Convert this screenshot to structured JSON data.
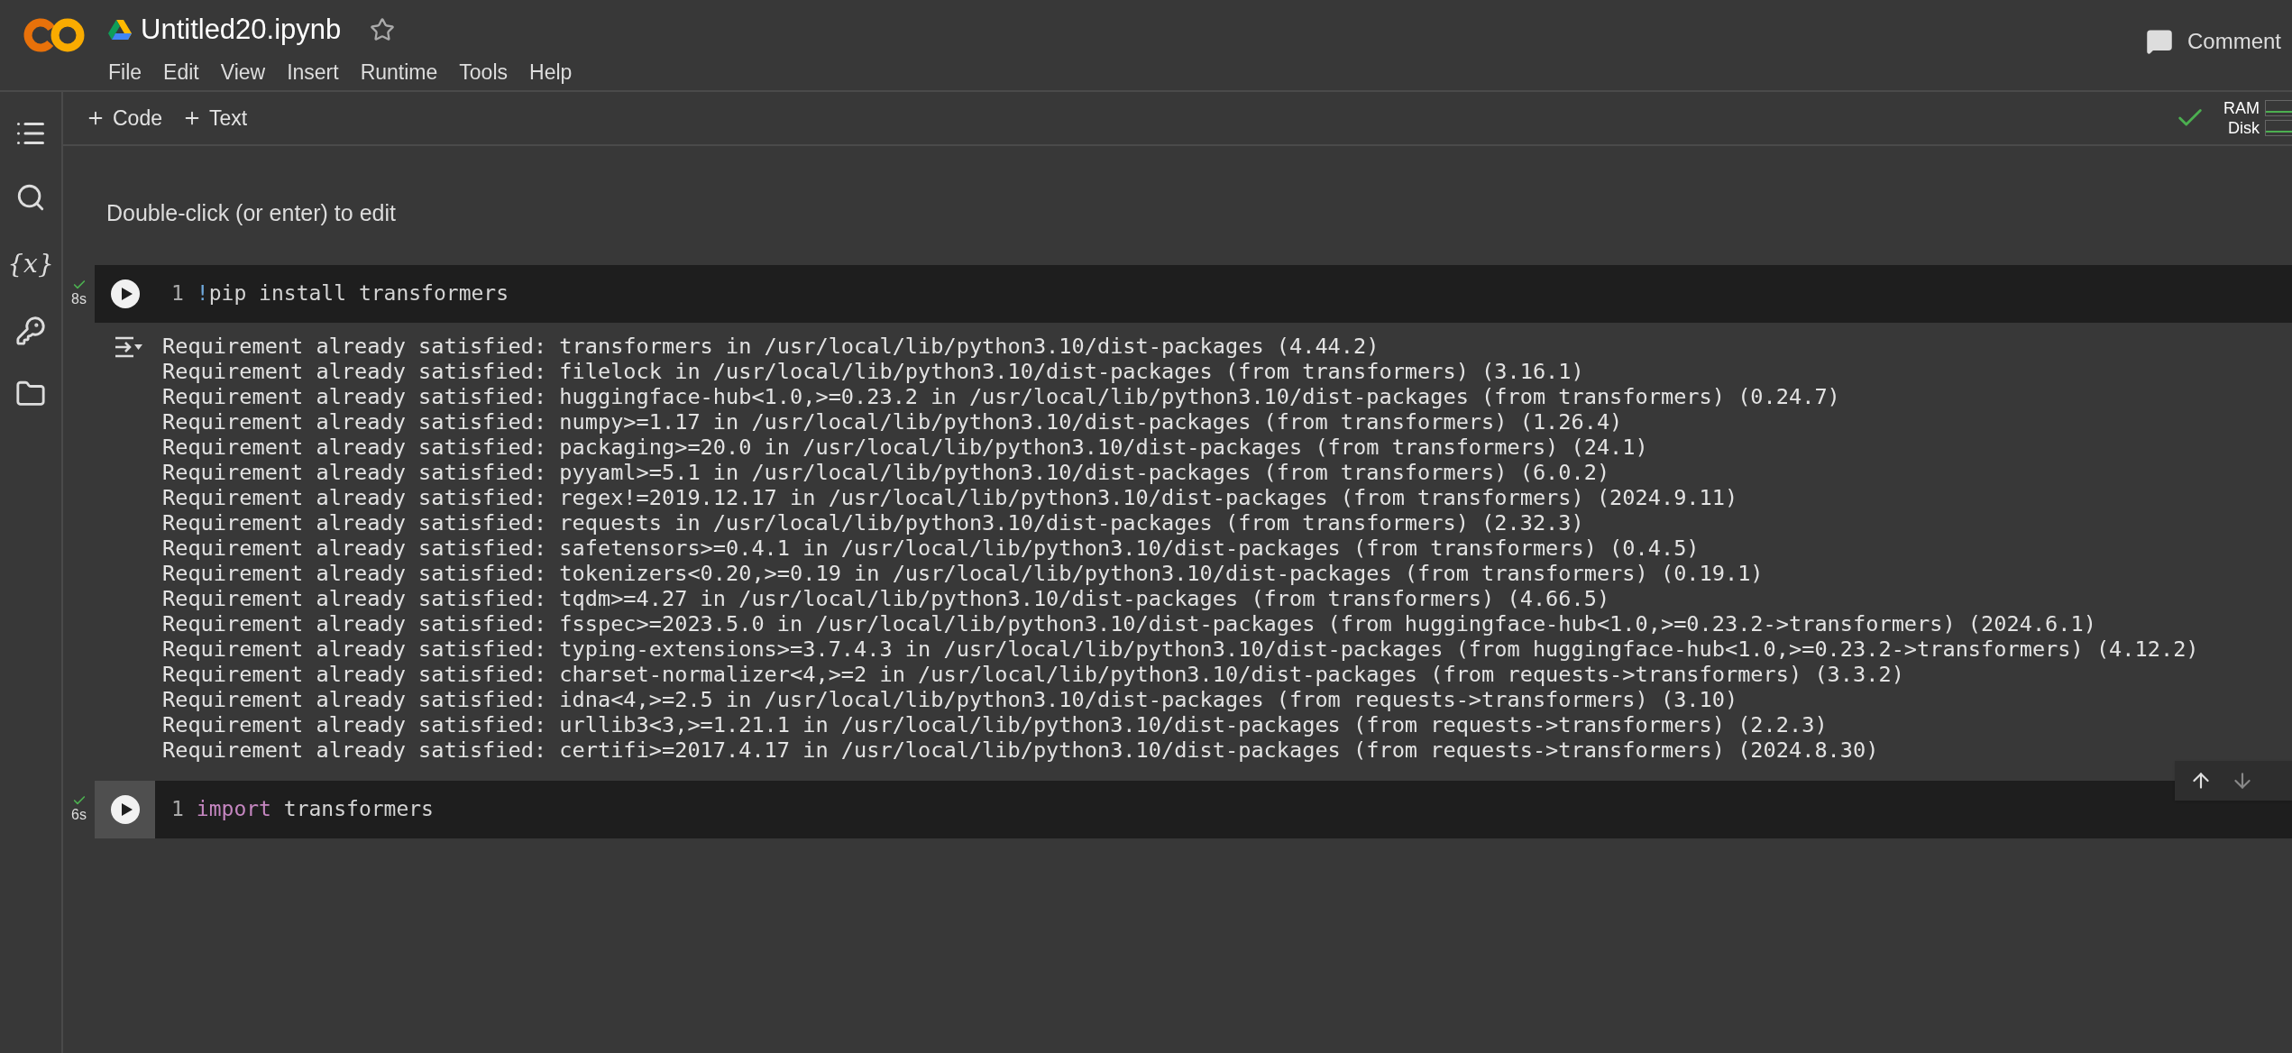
{
  "sidebar": {
    "variables_icon": "{x}"
  },
  "header": {
    "title": "Untitled20.ipynb",
    "starred": false,
    "menu": [
      "File",
      "Edit",
      "View",
      "Insert",
      "Runtime",
      "Tools",
      "Help"
    ],
    "comment_button": "Comment"
  },
  "toolbar": {
    "add_buttons": [
      "Code",
      "Text"
    ],
    "connected": true,
    "resources": [
      "RAM",
      "Disk"
    ]
  },
  "cells": [
    {
      "kind": "text",
      "text": "Double-click (or enter) to edit"
    },
    {
      "kind": "code",
      "focused": false,
      "succeeded": true,
      "duration": "8s",
      "line_number": "1",
      "tokens": [
        {
          "kind": "shell",
          "text": "!"
        },
        {
          "kind": "plain",
          "text": "pip install transformers"
        }
      ],
      "output": [
        "Requirement already satisfied: transformers in /usr/local/lib/python3.10/dist-packages (4.44.2)",
        "Requirement already satisfied: filelock in /usr/local/lib/python3.10/dist-packages (from transformers) (3.16.1)",
        "Requirement already satisfied: huggingface-hub<1.0,>=0.23.2 in /usr/local/lib/python3.10/dist-packages (from transformers) (0.24.7)",
        "Requirement already satisfied: numpy>=1.17 in /usr/local/lib/python3.10/dist-packages (from transformers) (1.26.4)",
        "Requirement already satisfied: packaging>=20.0 in /usr/local/lib/python3.10/dist-packages (from transformers) (24.1)",
        "Requirement already satisfied: pyyaml>=5.1 in /usr/local/lib/python3.10/dist-packages (from transformers) (6.0.2)",
        "Requirement already satisfied: regex!=2019.12.17 in /usr/local/lib/python3.10/dist-packages (from transformers) (2024.9.11)",
        "Requirement already satisfied: requests in /usr/local/lib/python3.10/dist-packages (from transformers) (2.32.3)",
        "Requirement already satisfied: safetensors>=0.4.1 in /usr/local/lib/python3.10/dist-packages (from transformers) (0.4.5)",
        "Requirement already satisfied: tokenizers<0.20,>=0.19 in /usr/local/lib/python3.10/dist-packages (from transformers) (0.19.1)",
        "Requirement already satisfied: tqdm>=4.27 in /usr/local/lib/python3.10/dist-packages (from transformers) (4.66.5)",
        "Requirement already satisfied: fsspec>=2023.5.0 in /usr/local/lib/python3.10/dist-packages (from huggingface-hub<1.0,>=0.23.2->transformers) (2024.6.1)",
        "Requirement already satisfied: typing-extensions>=3.7.4.3 in /usr/local/lib/python3.10/dist-packages (from huggingface-hub<1.0,>=0.23.2->transformers) (4.12.2)",
        "Requirement already satisfied: charset-normalizer<4,>=2 in /usr/local/lib/python3.10/dist-packages (from requests->transformers) (3.3.2)",
        "Requirement already satisfied: idna<4,>=2.5 in /usr/local/lib/python3.10/dist-packages (from requests->transformers) (3.10)",
        "Requirement already satisfied: urllib3<3,>=1.21.1 in /usr/local/lib/python3.10/dist-packages (from requests->transformers) (2.2.3)",
        "Requirement already satisfied: certifi>=2017.4.17 in /usr/local/lib/python3.10/dist-packages (from requests->transformers) (2024.8.30)"
      ]
    },
    {
      "kind": "code",
      "focused": true,
      "succeeded": true,
      "duration": "6s",
      "line_number": "1",
      "tokens": [
        {
          "kind": "keyword",
          "text": "import"
        },
        {
          "kind": "plain",
          "text": " transformers"
        }
      ]
    }
  ]
}
